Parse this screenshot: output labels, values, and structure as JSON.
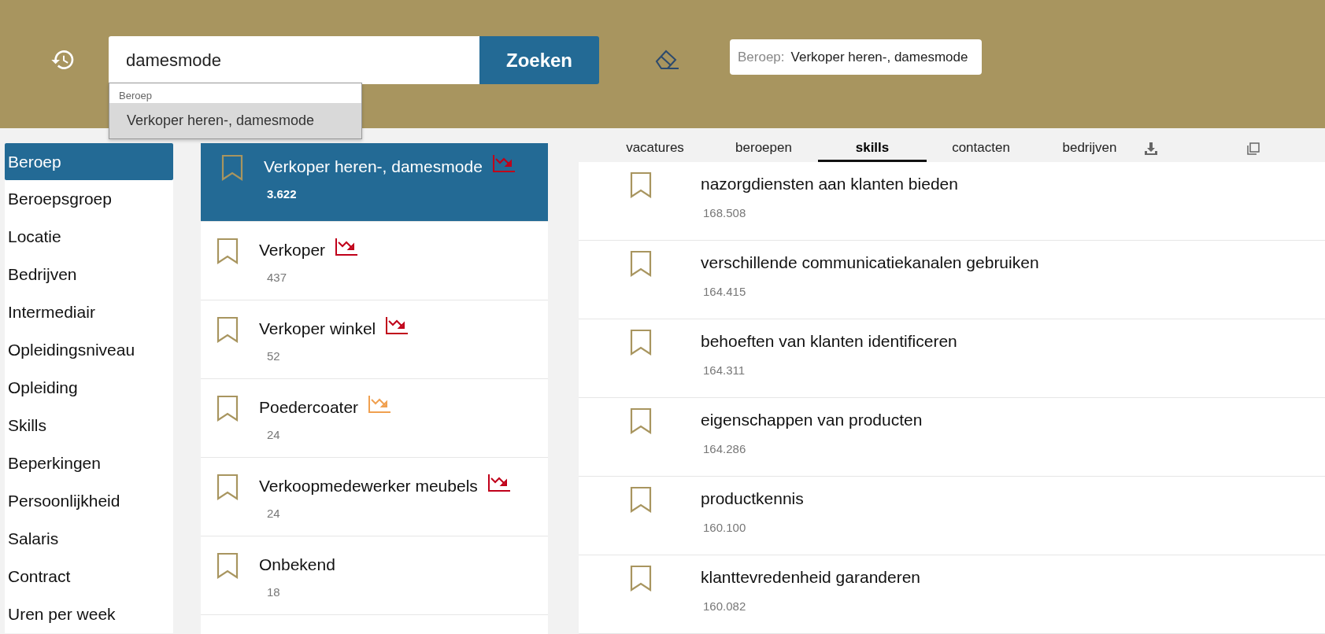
{
  "header": {
    "search": {
      "value": "damesmode"
    },
    "search_button": "Zoeken",
    "suggestions": {
      "group": "Beroep",
      "items": [
        {
          "label": "Verkoper heren-, damesmode",
          "selected": true
        }
      ]
    },
    "filter_chip": {
      "label": "Beroep:",
      "value": "Verkoper heren-, damesmode"
    }
  },
  "sidebar": {
    "items": [
      {
        "label": "Beroep",
        "selected": true
      },
      {
        "label": "Beroepsgroep",
        "selected": false
      },
      {
        "label": "Locatie",
        "selected": false
      },
      {
        "label": "Bedrijven",
        "selected": false
      },
      {
        "label": "Intermediair",
        "selected": false
      },
      {
        "label": "Opleidingsniveau",
        "selected": false
      },
      {
        "label": "Opleiding",
        "selected": false
      },
      {
        "label": "Skills",
        "selected": false
      },
      {
        "label": "Beperkingen",
        "selected": false
      },
      {
        "label": "Persoonlijkheid",
        "selected": false
      },
      {
        "label": "Salaris",
        "selected": false
      },
      {
        "label": "Contract",
        "selected": false
      },
      {
        "label": "Uren per week",
        "selected": false
      }
    ]
  },
  "occupations": [
    {
      "name": "Verkoper heren-, damesmode",
      "count": "3.622",
      "selected": true,
      "color": "#c0001a"
    },
    {
      "name": "Verkoper",
      "count": "437",
      "selected": false,
      "color": "#c0001a"
    },
    {
      "name": "Verkoper winkel",
      "count": "52",
      "selected": false,
      "color": "#c0001a"
    },
    {
      "name": "Poedercoater",
      "count": "24",
      "selected": false,
      "color": "#f0a050"
    },
    {
      "name": "Verkoopmedewerker meubels",
      "count": "24",
      "selected": false,
      "color": "#c0001a"
    },
    {
      "name": "Onbekend",
      "count": "18",
      "selected": false
    }
  ],
  "tabs": [
    {
      "label": "vacatures",
      "selected": false
    },
    {
      "label": "beroepen",
      "selected": false
    },
    {
      "label": "skills",
      "selected": true
    },
    {
      "label": "contacten",
      "selected": false
    },
    {
      "label": "bedrijven",
      "selected": false
    }
  ],
  "skills": [
    {
      "name": "nazorgdiensten aan klanten bieden",
      "count": "168.508"
    },
    {
      "name": "verschillende communicatiekanalen gebruiken",
      "count": "164.415"
    },
    {
      "name": "behoeften van klanten identificeren",
      "count": "164.311"
    },
    {
      "name": "eigenschappen van producten",
      "count": "164.286"
    },
    {
      "name": "productkennis",
      "count": "160.100"
    },
    {
      "name": "klanttevredenheid garanderen",
      "count": "160.082"
    }
  ]
}
